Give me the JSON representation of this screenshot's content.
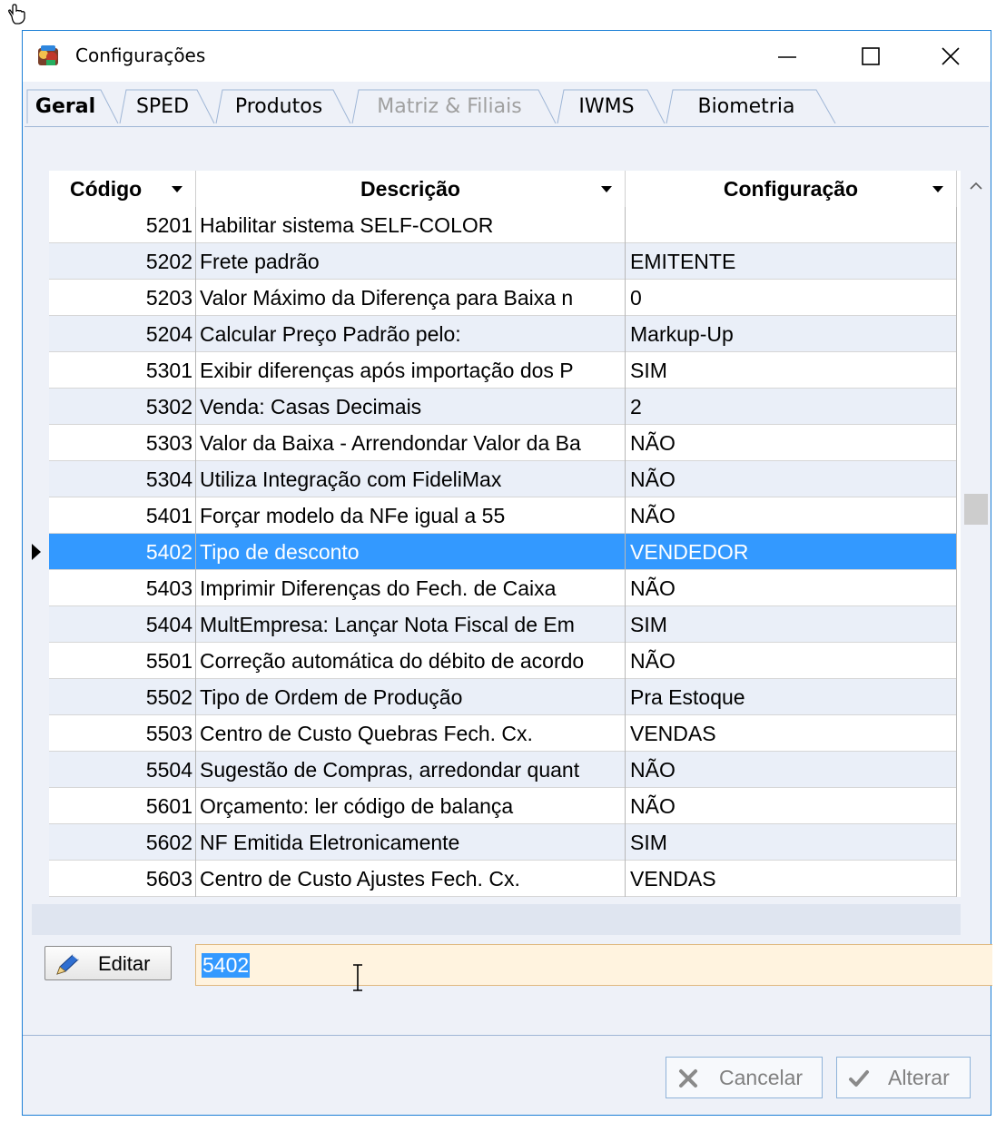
{
  "window": {
    "title": "Configurações"
  },
  "tabs": [
    {
      "label": "Geral",
      "state": "active"
    },
    {
      "label": "SPED",
      "state": "normal"
    },
    {
      "label": "Produtos",
      "state": "normal"
    },
    {
      "label": "Matriz & Filiais",
      "state": "disabled"
    },
    {
      "label": "IWMS",
      "state": "normal"
    },
    {
      "label": "Biometria",
      "state": "normal"
    }
  ],
  "grid": {
    "columns": {
      "code": "Código",
      "description": "Descrição",
      "config": "Configuração"
    },
    "selected_code": "5402",
    "rows": [
      {
        "code": "5201",
        "description": "Habilitar sistema SELF-COLOR",
        "config": ""
      },
      {
        "code": "5202",
        "description": "Frete padrão",
        "config": "EMITENTE"
      },
      {
        "code": "5203",
        "description": "Valor Máximo da Diferença para Baixa n",
        "config": "0"
      },
      {
        "code": "5204",
        "description": "Calcular Preço Padrão pelo:",
        "config": "Markup-Up"
      },
      {
        "code": "5301",
        "description": "Exibir diferenças após importação dos P",
        "config": "SIM"
      },
      {
        "code": "5302",
        "description": "Venda: Casas Decimais",
        "config": "2"
      },
      {
        "code": "5303",
        "description": "Valor da Baixa - Arrendondar Valor da Ba",
        "config": "NÃO"
      },
      {
        "code": "5304",
        "description": "Utiliza Integração com FideliMax",
        "config": "NÃO"
      },
      {
        "code": "5401",
        "description": "Forçar modelo da NFe igual a 55",
        "config": "NÃO"
      },
      {
        "code": "5402",
        "description": "Tipo de desconto",
        "config": "VENDEDOR"
      },
      {
        "code": "5403",
        "description": "Imprimir Diferenças do Fech. de Caixa",
        "config": "NÃO"
      },
      {
        "code": "5404",
        "description": "MultEmpresa: Lançar Nota Fiscal de Em",
        "config": "SIM"
      },
      {
        "code": "5501",
        "description": "Correção automática do débito de acordo",
        "config": "NÃO"
      },
      {
        "code": "5502",
        "description": "Tipo de Ordem de Produção",
        "config": "Pra Estoque"
      },
      {
        "code": "5503",
        "description": "Centro de Custo Quebras Fech. Cx.",
        "config": "VENDAS"
      },
      {
        "code": "5504",
        "description": "Sugestão de Compras, arredondar quant",
        "config": "NÃO"
      },
      {
        "code": "5601",
        "description": "Orçamento: ler código de balança",
        "config": "NÃO"
      },
      {
        "code": "5602",
        "description": "NF Emitida Eletronicamente",
        "config": "SIM"
      },
      {
        "code": "5603",
        "description": "Centro de Custo Ajustes Fech. Cx.",
        "config": "VENDAS"
      }
    ]
  },
  "edit_button": {
    "label": "Editar"
  },
  "search": {
    "value": "5402"
  },
  "footer": {
    "cancel_label": "Cancelar",
    "alter_label": "Alterar"
  },
  "colors": {
    "selection": "#3399ff",
    "row_alt": "#eaeff8",
    "input_bg": "#fff3df",
    "window_border": "#1c7fd6"
  }
}
